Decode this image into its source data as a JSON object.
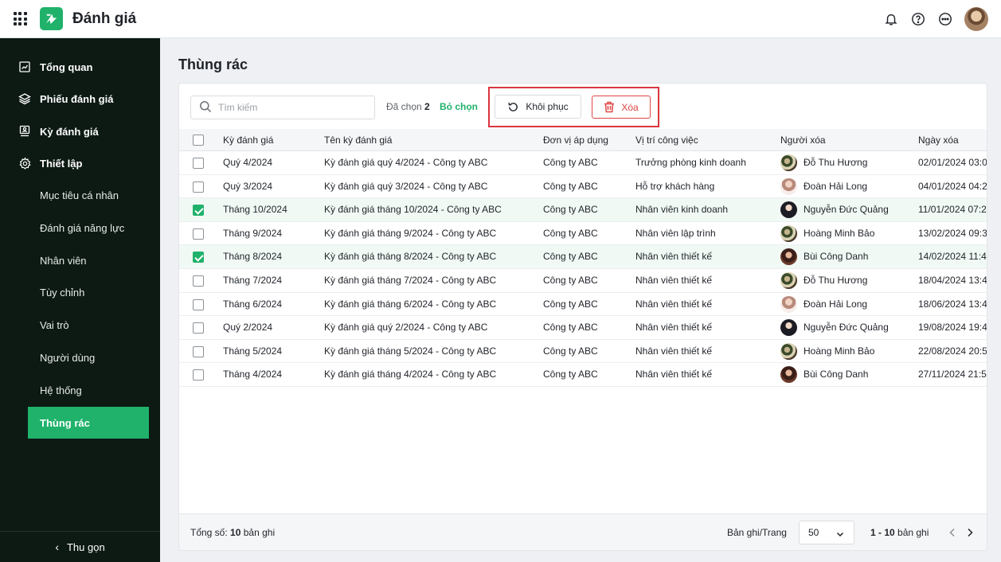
{
  "app": {
    "title": "Đánh giá"
  },
  "sidebar": {
    "sections": [
      {
        "label": "Tổng quan",
        "icon": "chart-board-icon"
      },
      {
        "label": "Phiếu đánh giá",
        "icon": "layers-icon"
      },
      {
        "label": "Kỳ đánh giá",
        "icon": "monitor-user-icon"
      },
      {
        "label": "Thiết lập",
        "icon": "gear-icon"
      }
    ],
    "sub_items": [
      {
        "label": "Mục tiêu cá nhân"
      },
      {
        "label": "Đánh giá năng lực"
      },
      {
        "label": "Nhân viên"
      },
      {
        "label": "Tùy chỉnh"
      },
      {
        "label": "Vai trò"
      },
      {
        "label": "Người dùng"
      },
      {
        "label": "Hệ thống"
      },
      {
        "label": "Thùng rác"
      }
    ],
    "active": "Thùng rác",
    "collapse_label": "Thu gọn"
  },
  "page": {
    "title": "Thùng rác"
  },
  "toolbar": {
    "search_placeholder": "Tìm kiếm",
    "selected_prefix": "Đã chọn",
    "selected_count": "2",
    "deselect_label": "Bỏ chọn",
    "restore_label": "Khôi phục",
    "delete_label": "Xóa"
  },
  "table": {
    "columns": [
      "Kỳ đánh giá",
      "Tên kỳ đánh giá",
      "Đơn vị áp dụng",
      "Vị trí công việc",
      "Người xóa",
      "Ngày xóa"
    ],
    "rows": [
      {
        "checked": false,
        "period": "Quý 4/2024",
        "name": "Kỳ đánh giá quý 4/2024 - Công ty ABC",
        "unit": "Công ty ABC",
        "position": "Trưởng phòng kinh doanh",
        "deleted_by": "Đỗ Thu Hương",
        "avatar": "a",
        "deleted_at": "02/01/2024 03:0"
      },
      {
        "checked": false,
        "period": "Quý 3/2024",
        "name": "Kỳ đánh giá quý 3/2024 - Công ty ABC",
        "unit": "Công ty ABC",
        "position": "Hỗ trợ khách hàng",
        "deleted_by": "Đoàn Hải Long",
        "avatar": "b",
        "deleted_at": "04/01/2024 04:2"
      },
      {
        "checked": true,
        "period": "Tháng 10/2024",
        "name": "Kỳ đánh giá tháng 10/2024 - Công ty ABC",
        "unit": "Công ty ABC",
        "position": "Nhân viên kinh doanh",
        "deleted_by": "Nguyễn Đức Quảng",
        "avatar": "c",
        "deleted_at": "11/01/2024 07:2"
      },
      {
        "checked": false,
        "period": "Tháng 9/2024",
        "name": "Kỳ đánh giá tháng 9/2024 - Công ty ABC",
        "unit": "Công ty ABC",
        "position": "Nhân viên lập trình",
        "deleted_by": "Hoàng Minh Bảo",
        "avatar": "a",
        "deleted_at": "13/02/2024 09:3"
      },
      {
        "checked": true,
        "period": "Tháng 8/2024",
        "name": "Kỳ đánh giá tháng 8/2024 - Công ty ABC",
        "unit": "Công ty ABC",
        "position": "Nhân viên thiết kế",
        "deleted_by": "Bùi Công Danh",
        "avatar": "d",
        "deleted_at": "14/02/2024 11:4"
      },
      {
        "checked": false,
        "period": "Tháng 7/2024",
        "name": "Kỳ đánh giá tháng 7/2024 - Công ty ABC",
        "unit": "Công ty ABC",
        "position": "Nhân viên thiết kế",
        "deleted_by": "Đỗ Thu Hương",
        "avatar": "a",
        "deleted_at": "18/04/2024 13:4"
      },
      {
        "checked": false,
        "period": "Tháng 6/2024",
        "name": "Kỳ đánh giá tháng 6/2024 - Công ty ABC",
        "unit": "Công ty ABC",
        "position": "Nhân viên thiết kế",
        "deleted_by": "Đoàn Hải Long",
        "avatar": "b",
        "deleted_at": "18/06/2024 13:4"
      },
      {
        "checked": false,
        "period": "Quý 2/2024",
        "name": "Kỳ đánh giá quý 2/2024 - Công ty ABC",
        "unit": "Công ty ABC",
        "position": "Nhân viên thiết kế",
        "deleted_by": "Nguyễn Đức Quảng",
        "avatar": "c",
        "deleted_at": "19/08/2024 19:4"
      },
      {
        "checked": false,
        "period": "Tháng 5/2024",
        "name": "Kỳ đánh giá tháng 5/2024 - Công ty ABC",
        "unit": "Công ty ABC",
        "position": "Nhân viên thiết kế",
        "deleted_by": "Hoàng Minh Bảo",
        "avatar": "a",
        "deleted_at": "22/08/2024 20:5"
      },
      {
        "checked": false,
        "period": "Tháng 4/2024",
        "name": "Kỳ đánh giá tháng 4/2024 - Công ty ABC",
        "unit": "Công ty ABC",
        "position": "Nhân viên thiết kế",
        "deleted_by": "Bùi Công Danh",
        "avatar": "d",
        "deleted_at": "27/11/2024 21:5"
      }
    ]
  },
  "footer": {
    "total_prefix": "Tổng số:",
    "total_count": "10",
    "total_suffix": "bản ghi",
    "per_page_label": "Bản ghi/Trang",
    "per_page_value": "50",
    "range_bold": "1 - 10",
    "range_suffix": "bản ghi"
  },
  "colors": {
    "accent": "#20b26b",
    "danger": "#e04545",
    "sidebar": "#0d1a14",
    "highlight": "#d9363e"
  }
}
